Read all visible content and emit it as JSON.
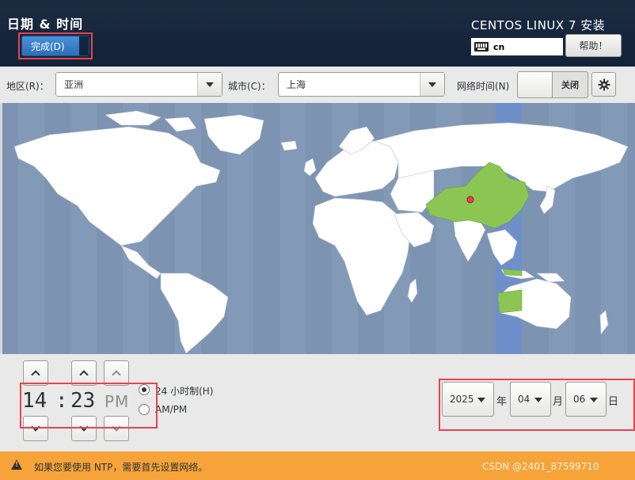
{
  "header": {
    "title": "日期 & 时间",
    "done_label": "完成(D)",
    "product_title": "CENTOS LINUX 7 安装",
    "keyboard_layout": "cn",
    "help_label": "帮助！"
  },
  "region_bar": {
    "region_label": "地区(R)：",
    "region_value": "亚洲",
    "city_label": "城市(C)：",
    "city_value": "上海",
    "network_time_label": "网络时间(N)",
    "network_time_state": "关闭"
  },
  "time": {
    "hours": "14",
    "separator": ":",
    "minutes": "23",
    "ampm": "PM",
    "format_24h_label": "24 小时制(H)",
    "format_ampm_label": "AM/PM",
    "selected_format": "24h"
  },
  "date": {
    "year": "2025",
    "year_unit": "年",
    "month": "04",
    "month_unit": "月",
    "day": "06",
    "day_unit": "日"
  },
  "status": {
    "message": "如果您要使用 NTP，需要首先设置网络。",
    "watermark": "CSDN @2401_87599710"
  },
  "colors": {
    "header_bg": "#1b2b40",
    "accent_blue": "#2c6fb7",
    "map_ocean": "#7d93b2",
    "land": "#ffffff",
    "selected_zone": "#8bc653",
    "status_bar": "#f6a33a",
    "highlight_red": "#e8434f"
  }
}
